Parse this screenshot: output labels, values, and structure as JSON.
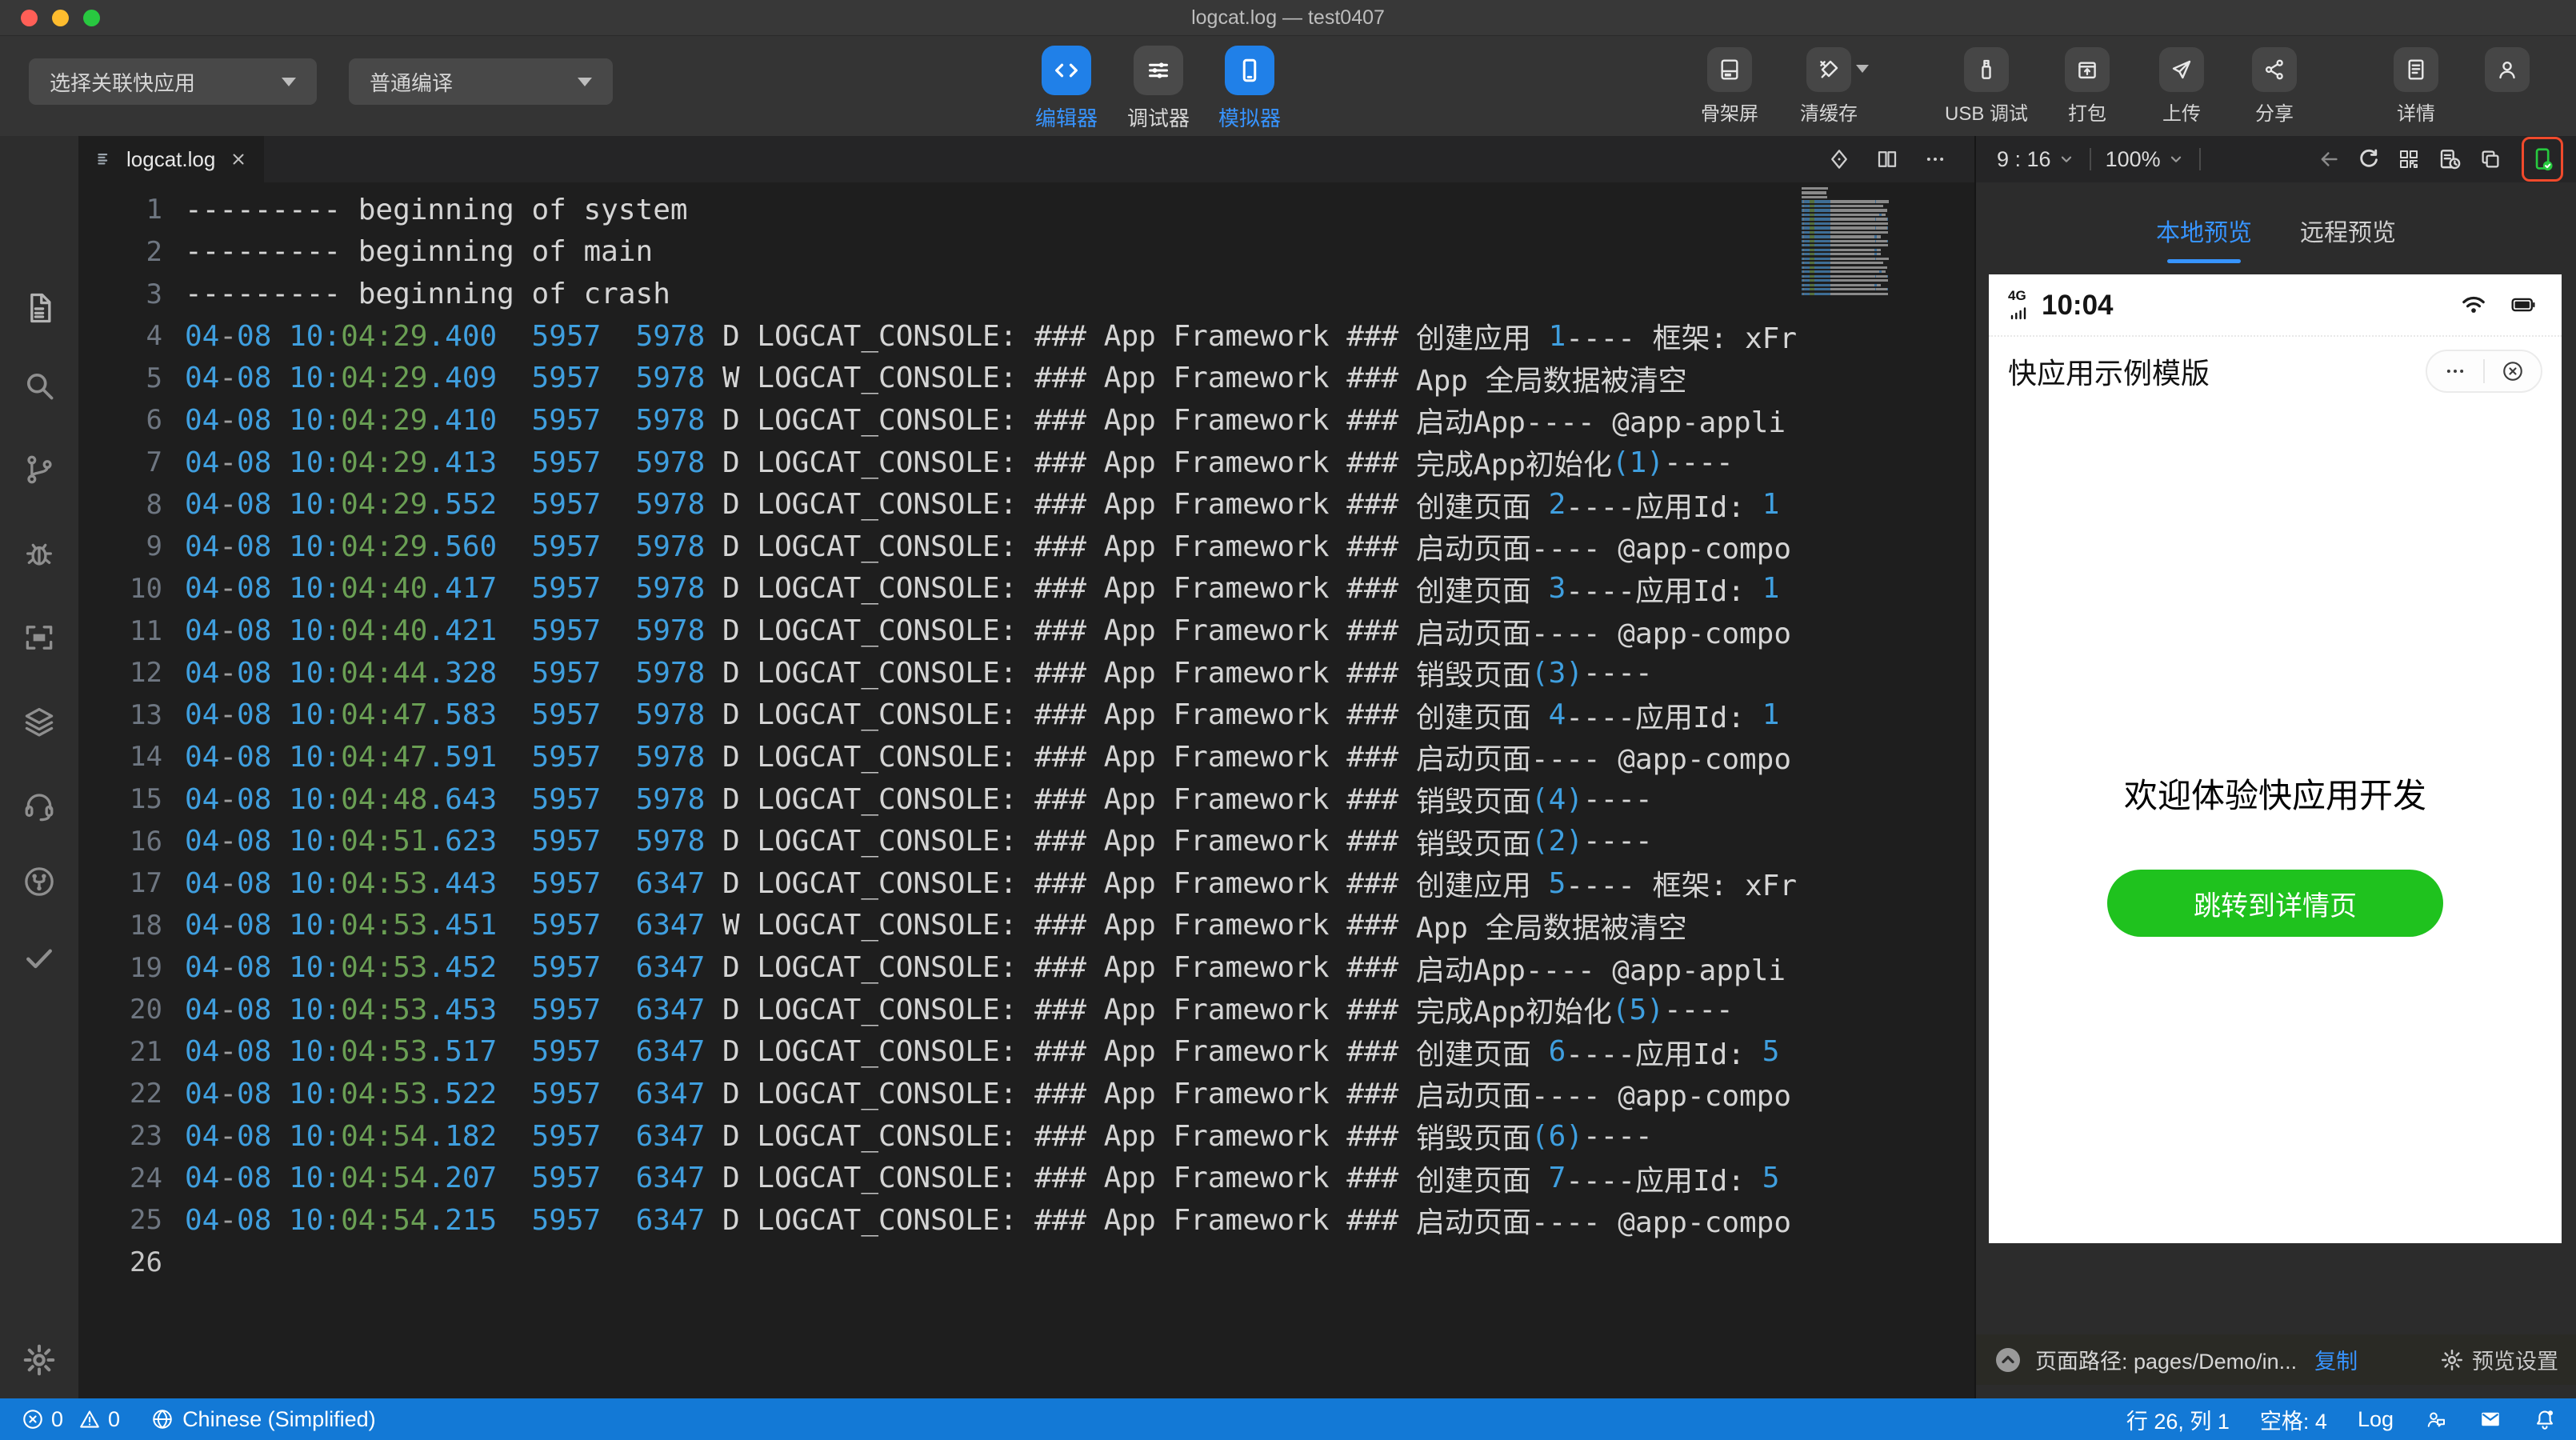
{
  "window": {
    "title": "logcat.log — test0407"
  },
  "toolbar": {
    "app_select": {
      "label": "选择关联快应用"
    },
    "compile_select": {
      "label": "普通编译"
    },
    "modes": [
      {
        "label": "编辑器",
        "icon": "code",
        "active": true
      },
      {
        "label": "调试器",
        "icon": "sliders",
        "active": false
      },
      {
        "label": "模拟器",
        "icon": "phone",
        "active": true
      }
    ],
    "actions": [
      {
        "label": "骨架屏",
        "icon": "skeleton"
      },
      {
        "label": "清缓存",
        "icon": "clear",
        "dropdown": true
      },
      {
        "label": "USB 调试",
        "icon": "usb"
      },
      {
        "label": "打包",
        "icon": "package"
      },
      {
        "label": "上传",
        "icon": "send"
      },
      {
        "label": "分享",
        "icon": "share"
      },
      {
        "label": "详情",
        "icon": "details"
      },
      {
        "label": "",
        "icon": "account"
      }
    ]
  },
  "activity_bar": {
    "items": [
      "explorer",
      "search",
      "source-control",
      "debug",
      "screenshot",
      "layers",
      "support",
      "share-circle",
      "check"
    ],
    "bottom": [
      "settings"
    ]
  },
  "editor": {
    "tab": {
      "label": "logcat.log"
    },
    "log_format": {
      "date_prefix": "04-08 10:",
      "pid": "5957",
      "tag": "LOGCAT_CONSOLE: ### App Framework ### "
    },
    "lines": [
      {
        "n": 1,
        "seg": [
          [
            "--------- beginning of system",
            "fg"
          ]
        ]
      },
      {
        "n": 2,
        "seg": [
          [
            "--------- beginning of main",
            "fg"
          ]
        ]
      },
      {
        "n": 3,
        "seg": [
          [
            "--------- beginning of crash",
            "fg"
          ]
        ]
      },
      {
        "n": 4,
        "ts": "04:29",
        "ms": ".400",
        "tid": "5978",
        "lv": "D",
        "seg": [
          [
            "创建应用 ",
            "fg"
          ],
          [
            "1",
            "num"
          ],
          [
            "---- 框架: xFr",
            "fg"
          ]
        ]
      },
      {
        "n": 5,
        "ts": "04:29",
        "ms": ".409",
        "tid": "5978",
        "lv": "W",
        "seg": [
          [
            "App 全局数据被清空",
            "fg"
          ]
        ]
      },
      {
        "n": 6,
        "ts": "04:29",
        "ms": ".410",
        "tid": "5978",
        "lv": "D",
        "seg": [
          [
            "启动App---- @app-appli",
            "fg"
          ]
        ]
      },
      {
        "n": 7,
        "ts": "04:29",
        "ms": ".413",
        "tid": "5978",
        "lv": "D",
        "seg": [
          [
            "完成App初始化",
            "fg"
          ],
          [
            "(1)",
            "num"
          ],
          [
            "----",
            "fg"
          ]
        ]
      },
      {
        "n": 8,
        "ts": "04:29",
        "ms": ".552",
        "tid": "5978",
        "lv": "D",
        "seg": [
          [
            "创建页面 ",
            "fg"
          ],
          [
            "2",
            "num"
          ],
          [
            "----应用Id: ",
            "fg"
          ],
          [
            "1",
            "num"
          ]
        ]
      },
      {
        "n": 9,
        "ts": "04:29",
        "ms": ".560",
        "tid": "5978",
        "lv": "D",
        "seg": [
          [
            "启动页面---- @app-compo",
            "fg"
          ]
        ]
      },
      {
        "n": 10,
        "ts": "04:40",
        "ms": ".417",
        "tid": "5978",
        "lv": "D",
        "seg": [
          [
            "创建页面 ",
            "fg"
          ],
          [
            "3",
            "num"
          ],
          [
            "----应用Id: ",
            "fg"
          ],
          [
            "1",
            "num"
          ]
        ]
      },
      {
        "n": 11,
        "ts": "04:40",
        "ms": ".421",
        "tid": "5978",
        "lv": "D",
        "seg": [
          [
            "启动页面---- @app-compo",
            "fg"
          ]
        ]
      },
      {
        "n": 12,
        "ts": "04:44",
        "ms": ".328",
        "tid": "5978",
        "lv": "D",
        "seg": [
          [
            "销毁页面",
            "fg"
          ],
          [
            "(3)",
            "num"
          ],
          [
            "----",
            "fg"
          ]
        ]
      },
      {
        "n": 13,
        "ts": "04:47",
        "ms": ".583",
        "tid": "5978",
        "lv": "D",
        "seg": [
          [
            "创建页面 ",
            "fg"
          ],
          [
            "4",
            "num"
          ],
          [
            "----应用Id: ",
            "fg"
          ],
          [
            "1",
            "num"
          ]
        ]
      },
      {
        "n": 14,
        "ts": "04:47",
        "ms": ".591",
        "tid": "5978",
        "lv": "D",
        "seg": [
          [
            "启动页面---- @app-compo",
            "fg"
          ]
        ]
      },
      {
        "n": 15,
        "ts": "04:48",
        "ms": ".643",
        "tid": "5978",
        "lv": "D",
        "seg": [
          [
            "销毁页面",
            "fg"
          ],
          [
            "(4)",
            "num"
          ],
          [
            "----",
            "fg"
          ]
        ]
      },
      {
        "n": 16,
        "ts": "04:51",
        "ms": ".623",
        "tid": "5978",
        "lv": "D",
        "seg": [
          [
            "销毁页面",
            "fg"
          ],
          [
            "(2)",
            "num"
          ],
          [
            "----",
            "fg"
          ]
        ]
      },
      {
        "n": 17,
        "ts": "04:53",
        "ms": ".443",
        "tid": "6347",
        "lv": "D",
        "seg": [
          [
            "创建应用 ",
            "fg"
          ],
          [
            "5",
            "num"
          ],
          [
            "---- 框架: xFr",
            "fg"
          ]
        ]
      },
      {
        "n": 18,
        "ts": "04:53",
        "ms": ".451",
        "tid": "6347",
        "lv": "W",
        "seg": [
          [
            "App 全局数据被清空",
            "fg"
          ]
        ]
      },
      {
        "n": 19,
        "ts": "04:53",
        "ms": ".452",
        "tid": "6347",
        "lv": "D",
        "seg": [
          [
            "启动App---- @app-appli",
            "fg"
          ]
        ]
      },
      {
        "n": 20,
        "ts": "04:53",
        "ms": ".453",
        "tid": "6347",
        "lv": "D",
        "seg": [
          [
            "完成App初始化",
            "fg"
          ],
          [
            "(5)",
            "num"
          ],
          [
            "----",
            "fg"
          ]
        ]
      },
      {
        "n": 21,
        "ts": "04:53",
        "ms": ".517",
        "tid": "6347",
        "lv": "D",
        "seg": [
          [
            "创建页面 ",
            "fg"
          ],
          [
            "6",
            "num"
          ],
          [
            "----应用Id: ",
            "fg"
          ],
          [
            "5",
            "num"
          ]
        ]
      },
      {
        "n": 22,
        "ts": "04:53",
        "ms": ".522",
        "tid": "6347",
        "lv": "D",
        "seg": [
          [
            "启动页面---- @app-compo",
            "fg"
          ]
        ]
      },
      {
        "n": 23,
        "ts": "04:54",
        "ms": ".182",
        "tid": "6347",
        "lv": "D",
        "seg": [
          [
            "销毁页面",
            "fg"
          ],
          [
            "(6)",
            "num"
          ],
          [
            "----",
            "fg"
          ]
        ]
      },
      {
        "n": 24,
        "ts": "04:54",
        "ms": ".207",
        "tid": "6347",
        "lv": "D",
        "seg": [
          [
            "创建页面 ",
            "fg"
          ],
          [
            "7",
            "num"
          ],
          [
            "----应用Id: ",
            "fg"
          ],
          [
            "5",
            "num"
          ]
        ]
      },
      {
        "n": 25,
        "ts": "04:54",
        "ms": ".215",
        "tid": "6347",
        "lv": "D",
        "seg": [
          [
            "启动页面---- @app-compo",
            "fg"
          ]
        ]
      },
      {
        "n": 26,
        "seg": []
      }
    ]
  },
  "preview": {
    "header": {
      "ratio": "9 : 16",
      "zoom": "100%"
    },
    "tabs": [
      {
        "label": "本地预览",
        "active": true
      },
      {
        "label": "远程预览",
        "active": false
      }
    ],
    "phone": {
      "network": "4G",
      "time": "10:04",
      "app_title": "快应用示例模版",
      "welcome": "欢迎体验快应用开发",
      "button_label": "跳转到详情页"
    },
    "footer": {
      "path_label": "页面路径: pages/Demo/in...",
      "copy_label": "复制",
      "settings_label": "预览设置"
    }
  },
  "status_bar": {
    "errors": "0",
    "warnings": "0",
    "language": "Chinese (Simplified)",
    "cursor": "行 26, 列 1",
    "indent": "空格: 4",
    "mode": "Log"
  },
  "colors": {
    "accent": "#3794ff",
    "status_bar": "#1379d6",
    "button_green": "#1fc21e",
    "highlight_red": "#f04a2c",
    "log_number_blue": "#3f9fdf",
    "log_time_green": "#6a9f54"
  }
}
